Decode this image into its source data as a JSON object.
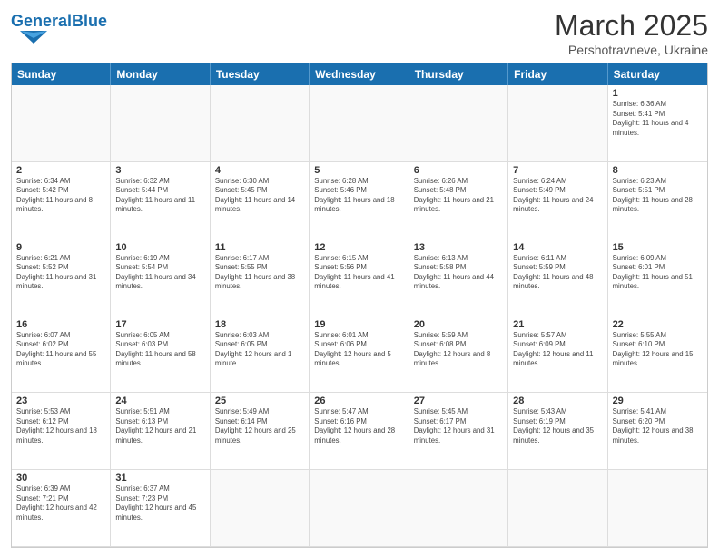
{
  "logo": {
    "text_general": "General",
    "text_blue": "Blue"
  },
  "title": {
    "month": "March 2025",
    "location": "Pershotravneve, Ukraine"
  },
  "header": {
    "days": [
      "Sunday",
      "Monday",
      "Tuesday",
      "Wednesday",
      "Thursday",
      "Friday",
      "Saturday"
    ]
  },
  "cells": [
    {
      "day": "",
      "info": ""
    },
    {
      "day": "",
      "info": ""
    },
    {
      "day": "",
      "info": ""
    },
    {
      "day": "",
      "info": ""
    },
    {
      "day": "",
      "info": ""
    },
    {
      "day": "",
      "info": ""
    },
    {
      "day": "1",
      "info": "Sunrise: 6:36 AM\nSunset: 5:41 PM\nDaylight: 11 hours and 4 minutes."
    },
    {
      "day": "2",
      "info": "Sunrise: 6:34 AM\nSunset: 5:42 PM\nDaylight: 11 hours and 8 minutes."
    },
    {
      "day": "3",
      "info": "Sunrise: 6:32 AM\nSunset: 5:44 PM\nDaylight: 11 hours and 11 minutes."
    },
    {
      "day": "4",
      "info": "Sunrise: 6:30 AM\nSunset: 5:45 PM\nDaylight: 11 hours and 14 minutes."
    },
    {
      "day": "5",
      "info": "Sunrise: 6:28 AM\nSunset: 5:46 PM\nDaylight: 11 hours and 18 minutes."
    },
    {
      "day": "6",
      "info": "Sunrise: 6:26 AM\nSunset: 5:48 PM\nDaylight: 11 hours and 21 minutes."
    },
    {
      "day": "7",
      "info": "Sunrise: 6:24 AM\nSunset: 5:49 PM\nDaylight: 11 hours and 24 minutes."
    },
    {
      "day": "8",
      "info": "Sunrise: 6:23 AM\nSunset: 5:51 PM\nDaylight: 11 hours and 28 minutes."
    },
    {
      "day": "9",
      "info": "Sunrise: 6:21 AM\nSunset: 5:52 PM\nDaylight: 11 hours and 31 minutes."
    },
    {
      "day": "10",
      "info": "Sunrise: 6:19 AM\nSunset: 5:54 PM\nDaylight: 11 hours and 34 minutes."
    },
    {
      "day": "11",
      "info": "Sunrise: 6:17 AM\nSunset: 5:55 PM\nDaylight: 11 hours and 38 minutes."
    },
    {
      "day": "12",
      "info": "Sunrise: 6:15 AM\nSunset: 5:56 PM\nDaylight: 11 hours and 41 minutes."
    },
    {
      "day": "13",
      "info": "Sunrise: 6:13 AM\nSunset: 5:58 PM\nDaylight: 11 hours and 44 minutes."
    },
    {
      "day": "14",
      "info": "Sunrise: 6:11 AM\nSunset: 5:59 PM\nDaylight: 11 hours and 48 minutes."
    },
    {
      "day": "15",
      "info": "Sunrise: 6:09 AM\nSunset: 6:01 PM\nDaylight: 11 hours and 51 minutes."
    },
    {
      "day": "16",
      "info": "Sunrise: 6:07 AM\nSunset: 6:02 PM\nDaylight: 11 hours and 55 minutes."
    },
    {
      "day": "17",
      "info": "Sunrise: 6:05 AM\nSunset: 6:03 PM\nDaylight: 11 hours and 58 minutes."
    },
    {
      "day": "18",
      "info": "Sunrise: 6:03 AM\nSunset: 6:05 PM\nDaylight: 12 hours and 1 minute."
    },
    {
      "day": "19",
      "info": "Sunrise: 6:01 AM\nSunset: 6:06 PM\nDaylight: 12 hours and 5 minutes."
    },
    {
      "day": "20",
      "info": "Sunrise: 5:59 AM\nSunset: 6:08 PM\nDaylight: 12 hours and 8 minutes."
    },
    {
      "day": "21",
      "info": "Sunrise: 5:57 AM\nSunset: 6:09 PM\nDaylight: 12 hours and 11 minutes."
    },
    {
      "day": "22",
      "info": "Sunrise: 5:55 AM\nSunset: 6:10 PM\nDaylight: 12 hours and 15 minutes."
    },
    {
      "day": "23",
      "info": "Sunrise: 5:53 AM\nSunset: 6:12 PM\nDaylight: 12 hours and 18 minutes."
    },
    {
      "day": "24",
      "info": "Sunrise: 5:51 AM\nSunset: 6:13 PM\nDaylight: 12 hours and 21 minutes."
    },
    {
      "day": "25",
      "info": "Sunrise: 5:49 AM\nSunset: 6:14 PM\nDaylight: 12 hours and 25 minutes."
    },
    {
      "day": "26",
      "info": "Sunrise: 5:47 AM\nSunset: 6:16 PM\nDaylight: 12 hours and 28 minutes."
    },
    {
      "day": "27",
      "info": "Sunrise: 5:45 AM\nSunset: 6:17 PM\nDaylight: 12 hours and 31 minutes."
    },
    {
      "day": "28",
      "info": "Sunrise: 5:43 AM\nSunset: 6:19 PM\nDaylight: 12 hours and 35 minutes."
    },
    {
      "day": "29",
      "info": "Sunrise: 5:41 AM\nSunset: 6:20 PM\nDaylight: 12 hours and 38 minutes."
    },
    {
      "day": "30",
      "info": "Sunrise: 6:39 AM\nSunset: 7:21 PM\nDaylight: 12 hours and 42 minutes."
    },
    {
      "day": "31",
      "info": "Sunrise: 6:37 AM\nSunset: 7:23 PM\nDaylight: 12 hours and 45 minutes."
    },
    {
      "day": "",
      "info": ""
    },
    {
      "day": "",
      "info": ""
    },
    {
      "day": "",
      "info": ""
    },
    {
      "day": "",
      "info": ""
    },
    {
      "day": "",
      "info": ""
    }
  ]
}
